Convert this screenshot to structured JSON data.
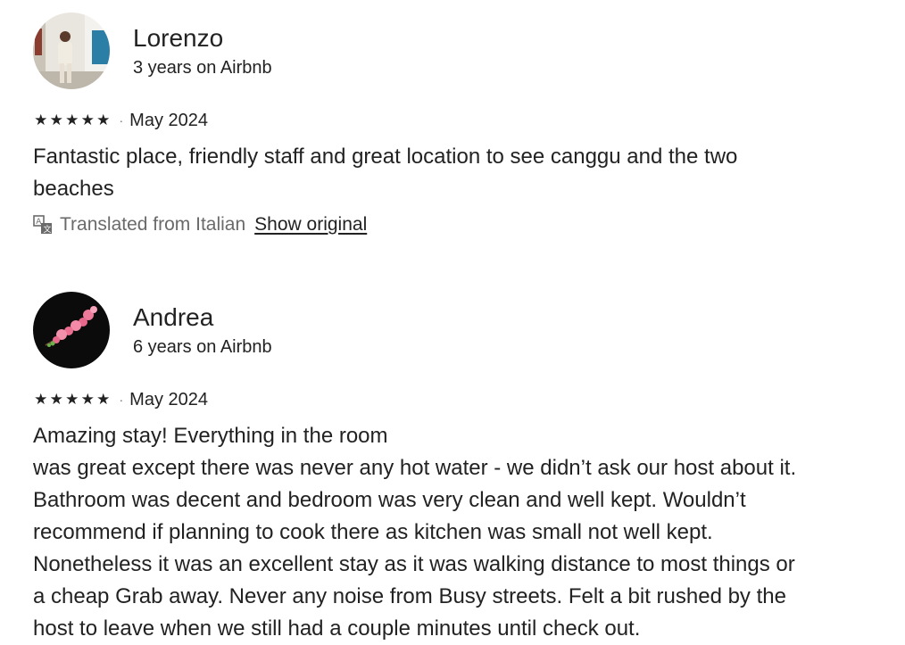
{
  "reviews": [
    {
      "name": "Lorenzo",
      "tenure": "3 years on Airbnb",
      "rating": 5,
      "stars": [
        "★",
        "★",
        "★",
        "★",
        "★"
      ],
      "separator": "·",
      "date": "May 2024",
      "text": "Fantastic place, friendly staff and great location to see canggu and the two\nbeaches",
      "translated_from": "Translated from Italian",
      "show_original_label": "Show original",
      "avatar": "photo-of-person-standing-in-white-street"
    },
    {
      "name": "Andrea",
      "tenure": "6 years on Airbnb",
      "rating": 5,
      "stars": [
        "★",
        "★",
        "★",
        "★",
        "★"
      ],
      "separator": "·",
      "date": "May 2024",
      "text": "Amazing stay! Everything in the room\nwas great except there was never any hot water - we didn’t ask our host about it.\nBathroom was decent and bedroom was very clean and well kept. Wouldn’t\nrecommend if planning to cook there as kitchen was small not well kept.\nNonetheless it was an excellent stay as it was walking distance to most things or\na cheap Grab away. Never any noise from Busy streets. Felt a bit rushed by the\nhost to leave when we still had a couple minutes until check out.",
      "avatar": "pink-blossom-on-black"
    }
  ],
  "colors": {
    "text": "#222222",
    "muted": "#6a6a6a",
    "background": "#ffffff"
  }
}
